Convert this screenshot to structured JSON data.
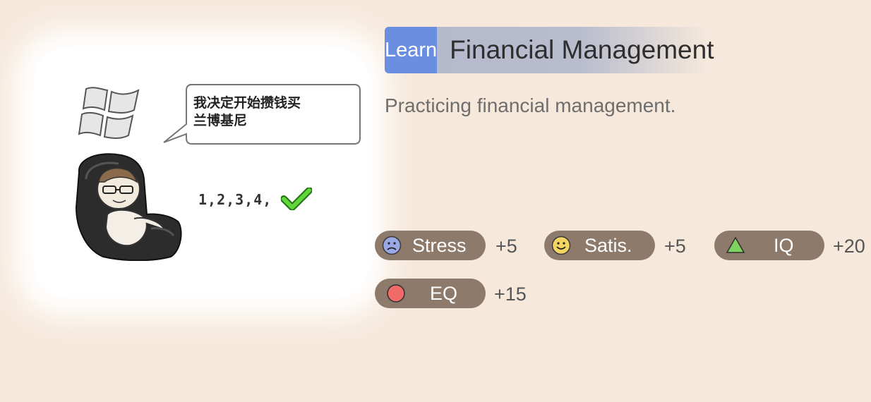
{
  "event": {
    "badge": "Learn",
    "title": "Financial Management",
    "description": "Practicing financial management.",
    "bubble_line1": "我决定开始攒钱买",
    "bubble_line2": "兰博基尼",
    "counting_text": "1,2,3,4,"
  },
  "stats": [
    {
      "label": "Stress",
      "delta": "+5",
      "icon": "sad-face-icon"
    },
    {
      "label": "Satis.",
      "delta": "+5",
      "icon": "smiley-face-icon"
    },
    {
      "label": "IQ",
      "delta": "+20",
      "icon": "triangle-icon"
    },
    {
      "label": "EQ",
      "delta": "+15",
      "icon": "circle-icon"
    }
  ],
  "colors": {
    "background": "#f6e9dc",
    "badge": "#6b8fe0",
    "pill": "#8e7a6a",
    "check": "#3fb618"
  }
}
